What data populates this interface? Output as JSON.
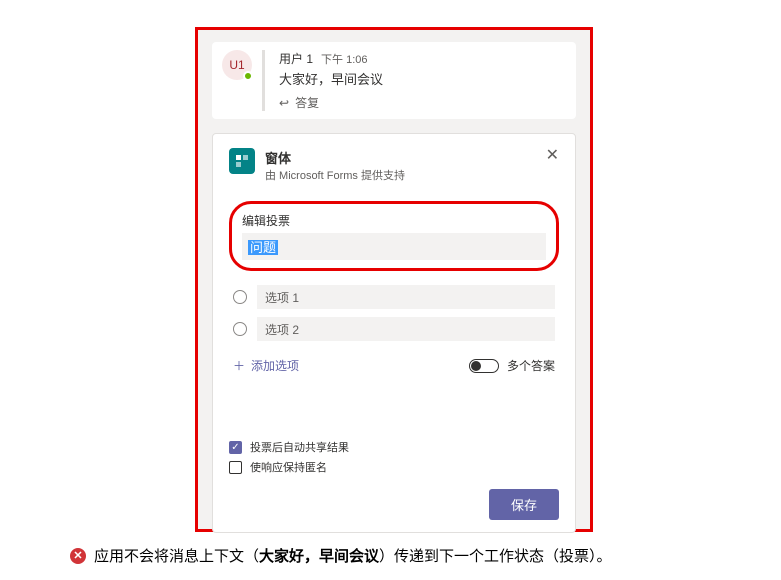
{
  "chat": {
    "avatar_initials": "U1",
    "user": "用户 1",
    "time": "下午 1:06",
    "text": "大家好，早间会议",
    "reply_label": "答复"
  },
  "poll": {
    "app_title": "窗体",
    "app_sub": "由 Microsoft Forms 提供支持",
    "edit_label": "编辑投票",
    "question_value": "问题",
    "options": [
      "选项 1",
      "选项 2"
    ],
    "add_option_label": "添加选项",
    "multi_label": "多个答案",
    "share_label": "投票后自动共享结果",
    "anon_label": "使响应保持匿名",
    "save_label": "保存"
  },
  "caption": {
    "pre": "应用不会将消息上下文（",
    "bold": "大家好，早间会议",
    "post": "）传递到下一个工作状态（投票）。"
  }
}
